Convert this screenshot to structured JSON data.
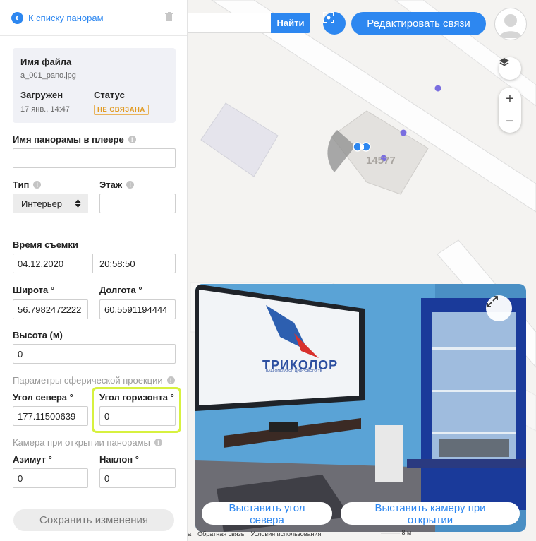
{
  "sidebar": {
    "back_label": "К списку панорам",
    "file_card": {
      "title": "Имя файла",
      "file_name": "a_001_pano.jpg",
      "uploaded_label": "Загружен",
      "uploaded_value": "17 янв., 14:47",
      "status_label": "Статус",
      "status_value": "НЕ СВЯЗАНА"
    },
    "player_name_label": "Имя панорамы в плеере",
    "player_name_value": "",
    "type_label": "Тип",
    "type_value": "Интерьер",
    "floor_label": "Этаж",
    "floor_value": "",
    "shot_time_label": "Время съемки",
    "date_value": "04.12.2020",
    "time_value": "20:58:50",
    "latitude_label": "Широта °",
    "latitude_value": "56.7982472222",
    "longitude_label": "Долгота °",
    "longitude_value": "60.5591194444",
    "height_label": "Высота (м)",
    "height_value": "0",
    "sphere_params_label": "Параметры сферической проекции",
    "north_angle_label": "Угол севера °",
    "north_angle_value": "177.11500639",
    "horizon_angle_label": "Угол горизонта °",
    "horizon_angle_value": "0",
    "camera_open_label": "Камера при открытии панорамы",
    "azimuth_label": "Азимут °",
    "azimuth_value": "0",
    "tilt_label": "Наклон °",
    "tilt_value": "0",
    "save_label": "Сохранить изменения"
  },
  "topbar": {
    "search_value": "",
    "search_button": "Найти",
    "edit_links_button": "Редактировать связи"
  },
  "map": {
    "building_label": "14577",
    "layers_icon": "layers-icon",
    "zoom_in": "+",
    "zoom_out": "−"
  },
  "panorama": {
    "tv_brand": "ТРИКОЛОР",
    "tv_tagline": "ВАШ ОПЕРАТОР ЦИФРОВОГО ТВ",
    "set_north_button": "Выставить угол севера",
    "set_camera_button": "Выставить камеру при открытии"
  },
  "footer": {
    "link_partial": "ка",
    "feedback": "Обратная связь",
    "terms": "Условия использования",
    "scale": "8 м"
  },
  "colors": {
    "accent": "#2d87f0",
    "status_warning": "#e19a22",
    "highlight": "#d7f13f"
  }
}
